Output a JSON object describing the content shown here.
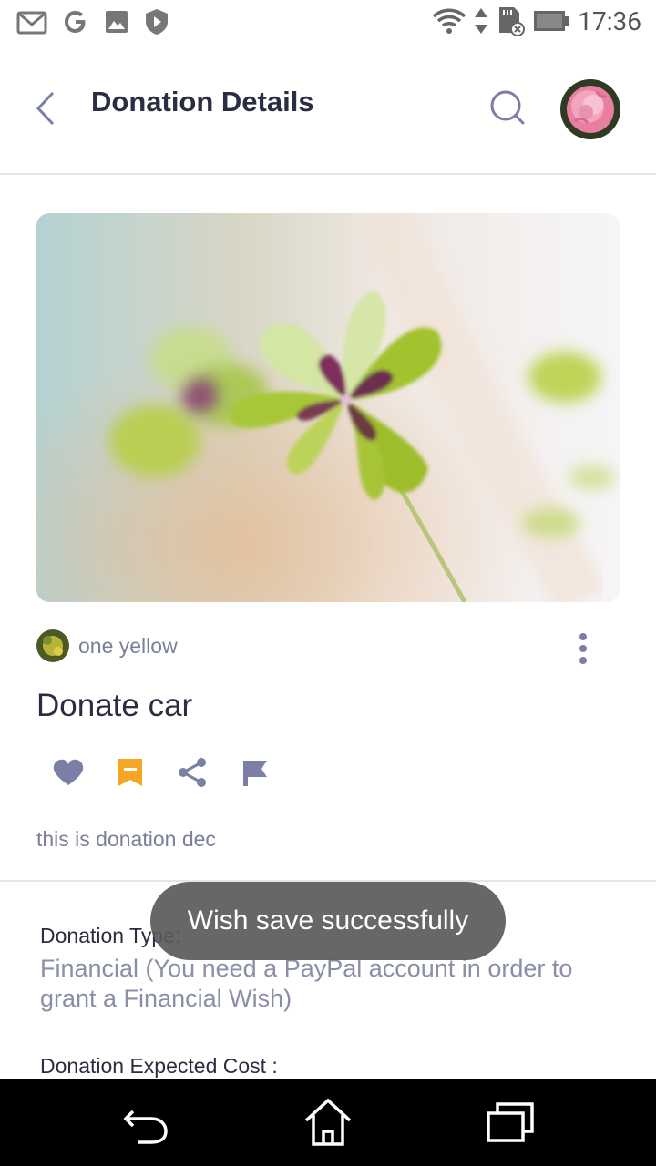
{
  "status_bar": {
    "time": "17:36",
    "left_icons": [
      "gmail-icon",
      "google-icon",
      "photos-icon",
      "play-protect-icon"
    ],
    "right_icons": [
      "wifi-icon",
      "data-arrows-icon",
      "sd-card-icon",
      "battery-icon"
    ]
  },
  "header": {
    "title": "Donation Details",
    "icons": {
      "back": "back-arrow-icon",
      "search": "search-icon",
      "avatar": "user-avatar"
    }
  },
  "post": {
    "author": "one yellow",
    "title": "Donate car",
    "description": "this is donation dec",
    "actions": [
      "like-icon",
      "bookmark-icon",
      "share-icon",
      "flag-icon"
    ],
    "colors": {
      "icon": "#7b7fa6",
      "bookmark_active": "#f5a623"
    }
  },
  "details": {
    "type_label": "Donation Type:",
    "type_value": "Financial (You need a PayPal account in order to grant a Financial Wish)",
    "cost_label": "Donation Expected Cost :"
  },
  "toast": {
    "message": "Wish save successfully"
  },
  "nav": {
    "buttons": [
      "back-nav-icon",
      "home-nav-icon",
      "recents-nav-icon"
    ]
  }
}
